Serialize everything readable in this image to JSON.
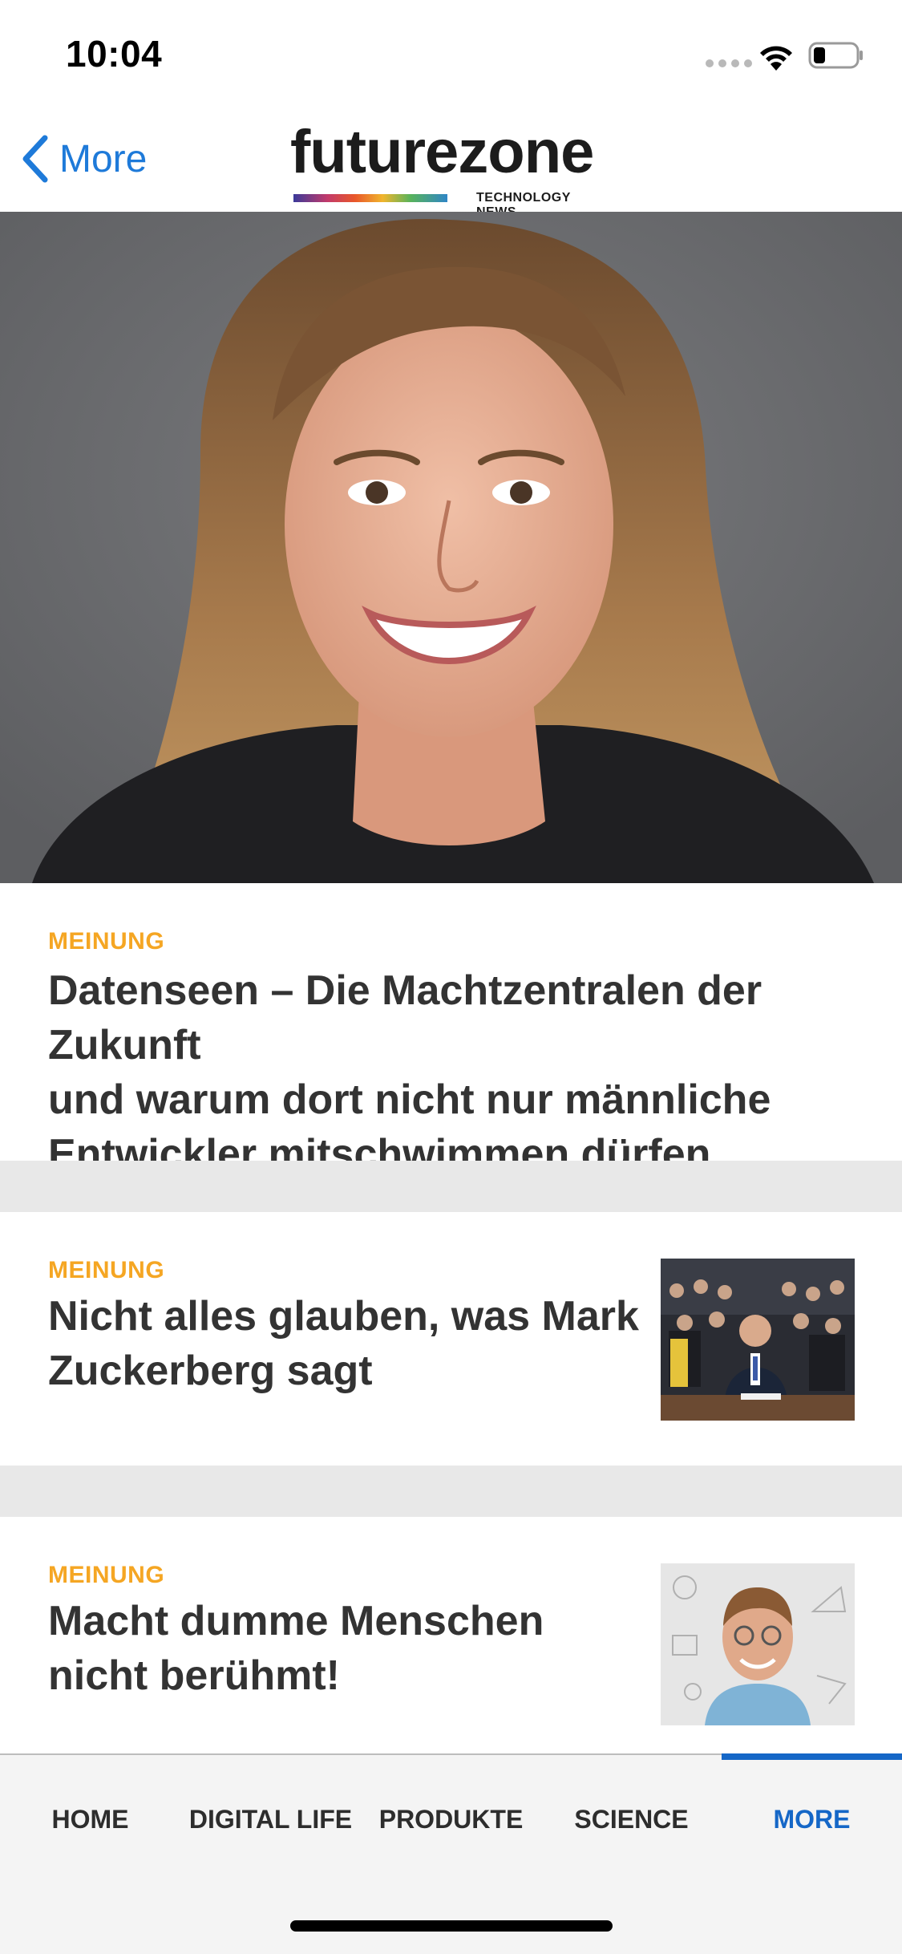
{
  "status_bar": {
    "time": "10:04"
  },
  "nav": {
    "back_label": "More",
    "logo_text": "futurezone",
    "logo_tagline": "TECHNOLOGY NEWS"
  },
  "articles": [
    {
      "kicker": "MEINUNG",
      "headline_lines": [
        "Datenseen – Die Machtzentralen der Zukunft",
        "und warum dort nicht nur männliche",
        "Entwickler mitschwimmen dürfen"
      ]
    },
    {
      "kicker": "MEINUNG",
      "headline_lines": [
        "Nicht alles glauben, was Mark",
        "Zuckerberg sagt"
      ]
    },
    {
      "kicker": "MEINUNG",
      "headline_lines": [
        "Macht dumme Menschen",
        "nicht berühmt!"
      ]
    }
  ],
  "tabs": [
    {
      "label": "HOME"
    },
    {
      "label": "DIGITAL LIFE"
    },
    {
      "label": "PRODUKTE"
    },
    {
      "label": "SCIENCE"
    },
    {
      "label": "MORE",
      "active": true
    }
  ],
  "colors": {
    "accent_blue": "#1567c7",
    "back_blue": "#1e7ad9",
    "kicker_orange": "#f5a623",
    "separator_gray": "#e8e8e8"
  },
  "icons": [
    "wifi-icon",
    "battery-icon",
    "back-chevron-icon"
  ]
}
